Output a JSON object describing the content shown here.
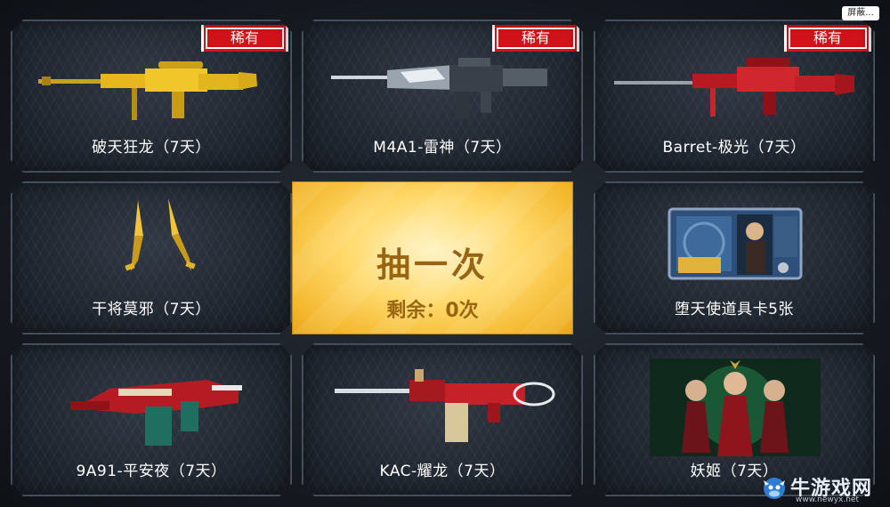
{
  "top_button": "屏蔽...",
  "rare_label": "稀有",
  "items": [
    {
      "name": "破天狂龙（7天）",
      "rare": true,
      "icon": "gold-sniper-rifle-icon"
    },
    {
      "name": "M4A1-雷神（7天）",
      "rare": true,
      "icon": "m4a1-rifle-icon"
    },
    {
      "name": "Barret-极光（7天）",
      "rare": true,
      "icon": "red-sniper-rifle-icon"
    },
    {
      "name": "干将莫邪（7天）",
      "rare": false,
      "icon": "twin-daggers-icon"
    },
    {
      "name": "堕天使道具卡5张",
      "rare": false,
      "icon": "item-card-icon"
    },
    {
      "name": "9A91-平安夜（7天）",
      "rare": false,
      "icon": "christmas-rifle-icon"
    },
    {
      "name": "KAC-耀龙（7天）",
      "rare": false,
      "icon": "machine-gun-icon"
    },
    {
      "name": "妖姬（7天）",
      "rare": false,
      "icon": "character-portrait-icon"
    }
  ],
  "draw": {
    "title": "抽一次",
    "remaining": "剩余：0次"
  },
  "watermark": {
    "text": "牛游戏网",
    "url": "www.newyx.net"
  },
  "colors": {
    "rare_badge": "#d2141a",
    "draw_panel": "#f6c545",
    "draw_text": "#9a6512"
  }
}
